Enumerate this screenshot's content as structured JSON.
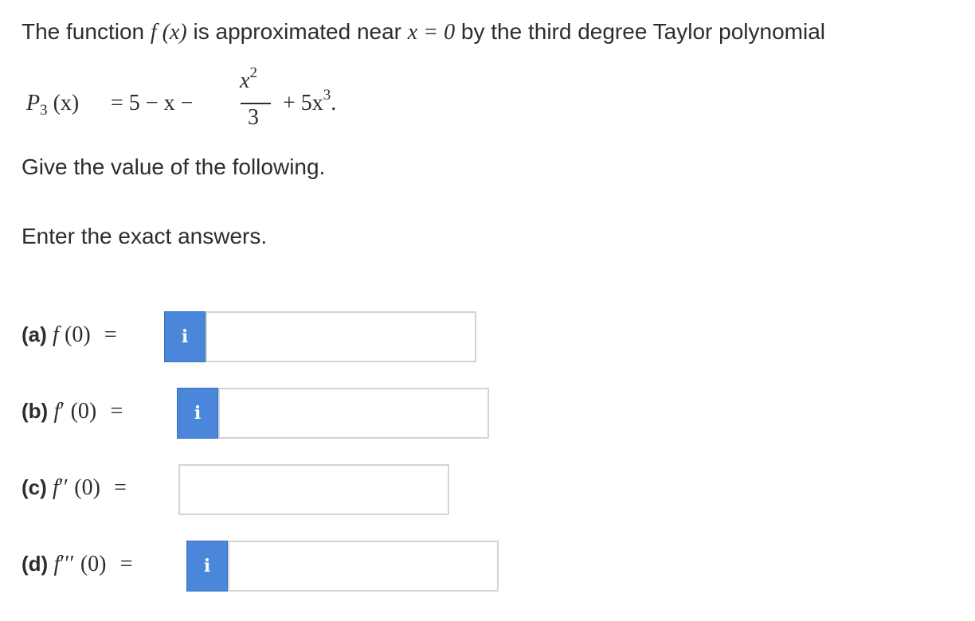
{
  "intro": {
    "text_before": "The function",
    "fx": "f (x)",
    "text_mid": "is approximated near",
    "x_eq": "x = 0",
    "text_after": "by the third degree Taylor polynomial"
  },
  "polynomial": {
    "lhs_P": "P",
    "lhs_sub": "3",
    "lhs_arg": "(x)",
    "rhs_start": "= 5 − x −",
    "frac_num_base": "x",
    "frac_num_exp": "2",
    "frac_den": "3",
    "rhs_plus": "+ 5x",
    "rhs_exp": "3",
    "rhs_end": "."
  },
  "instructions": {
    "give_value": "Give the value of the following.",
    "exact": "Enter the exact answers."
  },
  "questions": [
    {
      "letter": "(a)",
      "f": "f",
      "prime": "",
      "arg": "(0)",
      "eq": "=",
      "has_info": true,
      "info_label": "i",
      "value": ""
    },
    {
      "letter": "(b)",
      "f": "f",
      "prime": "′",
      "arg": "(0)",
      "eq": "=",
      "has_info": true,
      "info_label": "i",
      "value": ""
    },
    {
      "letter": "(c)",
      "f": "f",
      "prime": "′′",
      "arg": "(0)",
      "eq": "=",
      "has_info": false,
      "info_label": "",
      "value": ""
    },
    {
      "letter": "(d)",
      "f": "f",
      "prime": "′′′",
      "arg": "(0)",
      "eq": "=",
      "has_info": true,
      "info_label": "i",
      "value": ""
    }
  ],
  "colors": {
    "info_button_bg": "#4a86d9",
    "input_border": "#d4d4d4",
    "text": "#2d2d2d"
  }
}
